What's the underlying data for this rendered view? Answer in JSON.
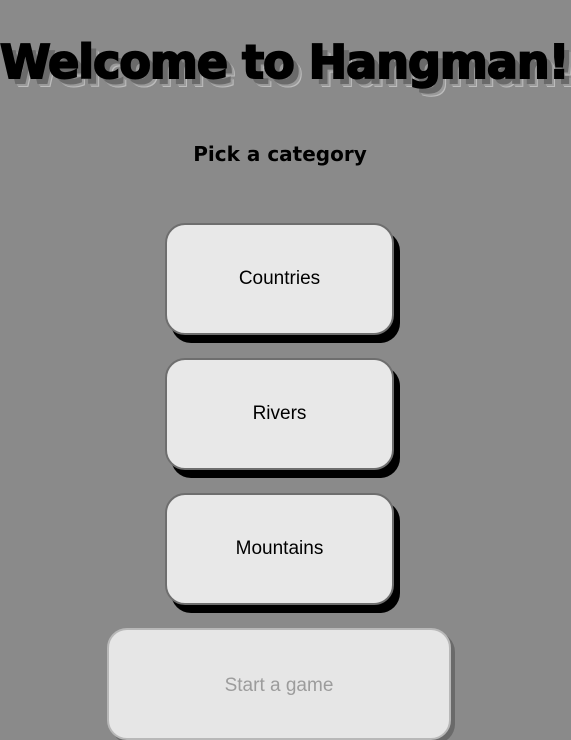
{
  "header": {
    "title": "Welcome to Hangman!!",
    "subtitle": "Pick a category"
  },
  "categories": [
    {
      "label": "Countries"
    },
    {
      "label": "Rivers"
    },
    {
      "label": "Mountains"
    }
  ],
  "start": {
    "label": "Start a game",
    "disabled": true
  },
  "colors": {
    "background": "#8a8a8a",
    "button_face": "#e8e8e8",
    "button_shadow": "#000000",
    "disabled_text": "#9c9c9c"
  }
}
